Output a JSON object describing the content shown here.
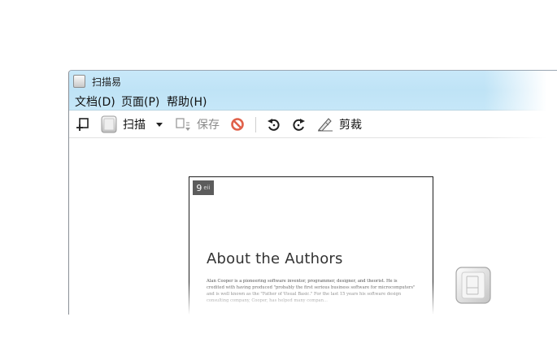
{
  "window": {
    "title": "扫描易"
  },
  "menu": {
    "items": [
      "文档(D)",
      "页面(P)",
      "帮助(H)"
    ]
  },
  "toolbar": {
    "scan_label": "扫描",
    "save_label": "保存",
    "crop_label": "剪裁"
  },
  "page": {
    "number": "9",
    "number_suffix": "eii",
    "heading": "About the Authors",
    "paragraph": "Alan Cooper is a pioneering software inventor, programmer, designer, and theorist. He is credited with having produced \"probably the first serious business software for microcomputers\" and is well known as the \"Father of Visual Basic.\" For the last 15 years his software design consulting company, Cooper, has helped many compan..."
  },
  "colors": {
    "titlebar": "#c8e8f9",
    "menubar": "#bfe3f6",
    "stop_icon": "#e0614a"
  }
}
